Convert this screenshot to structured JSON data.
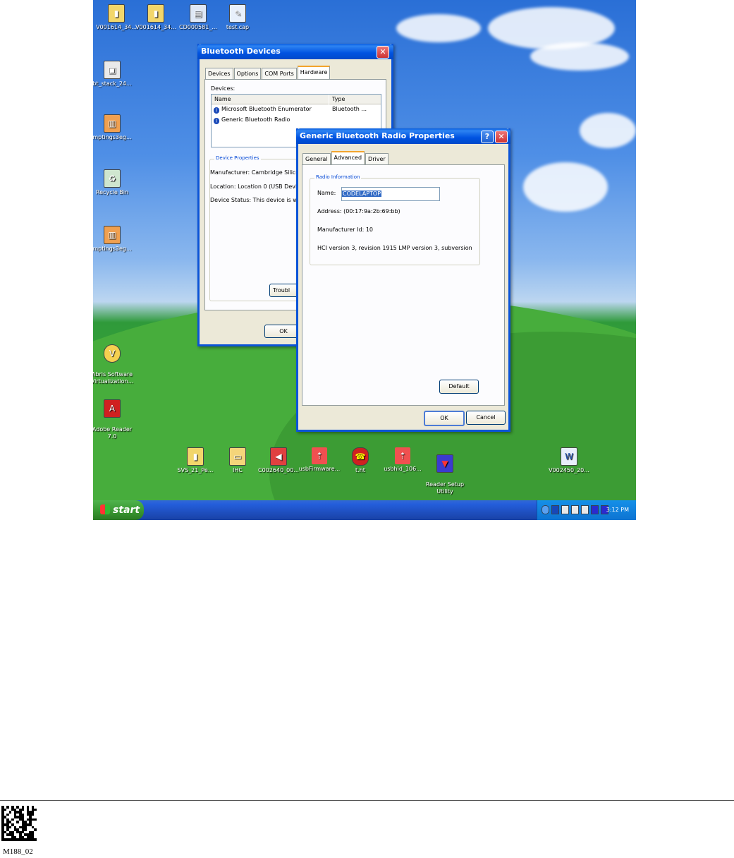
{
  "desktop": {
    "top_icons": [
      "V001614_34...",
      "V001614_34...",
      "CD000581_...",
      "test.cap"
    ],
    "left_icons": [
      "bt_stack_24...",
      "mptings3eg...",
      "Recycle Bin",
      "mptings3eg...",
      "Abris Software\nVirtualization...",
      "Adobe Reader\n7.0"
    ],
    "bottom_icons": [
      "SVS_21_Pe...",
      "IHC",
      "C002640_00...",
      "usbFirmware...",
      "t.ht",
      "usbhid_106...",
      "Reader Setup\nUtility",
      "V002450_20..."
    ]
  },
  "taskbar": {
    "start_label": "start",
    "clock": "3:12 PM"
  },
  "bt_devices_window": {
    "title": "Bluetooth Devices",
    "tabs": [
      "Devices",
      "Options",
      "COM Ports",
      "Hardware"
    ],
    "devices_label": "Devices:",
    "columns": [
      "Name",
      "Type"
    ],
    "rows": [
      {
        "name": "Microsoft Bluetooth Enumerator",
        "type": "Bluetooth ..."
      },
      {
        "name": "Generic Bluetooth Radio",
        "type": ""
      }
    ],
    "device_properties_title": "Device Properties",
    "manufacturer": "Manufacturer: Cambridge Silicor",
    "location": "Location: Location 0 (USB Devi",
    "status": "Device Status: This device is w",
    "troubleshoot_label": "Troubl",
    "ok_label": "OK"
  },
  "radio_props_window": {
    "title": "Generic Bluetooth Radio Properties",
    "tabs": [
      "General",
      "Advanced",
      "Driver"
    ],
    "group_title": "Radio Information",
    "name_label": "Name:",
    "name_value": "CODELAPTOP",
    "address": "Address:    (00:17:9a:2b:69:bb)",
    "manufacturer_id": "Manufacturer Id:    10",
    "hci": "HCI version 3, revision 1915  LMP version 3, subversion",
    "default_label": "Default",
    "ok_label": "OK",
    "cancel_label": "Cancel"
  },
  "footer": {
    "label": "M188_02"
  },
  "colors": {
    "xp_blue": "#0053e1",
    "dialog_bg": "#ece9d8",
    "start_green": "#37942f"
  }
}
